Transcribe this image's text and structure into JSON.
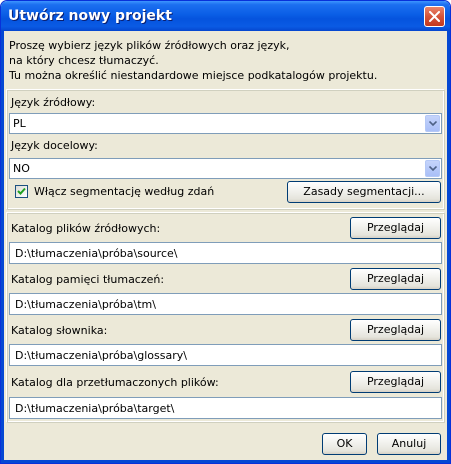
{
  "window": {
    "title": "Utwórz nowy projekt"
  },
  "intro": "Proszę wybierz język plików źródłowych oraz język,\nna który chcesz tłumaczyć.\nTu można określić niestandardowe miejsce podkatalogów projektu.",
  "languages": {
    "source_label": "Język źródłowy:",
    "source_value": "PL",
    "target_label": "Język docelowy:",
    "target_value": "NO",
    "segmentation_checkbox_label": "Włącz segmentację według zdań",
    "segmentation_checked": true,
    "segmentation_rules_button": "Zasady segmentacji..."
  },
  "directories": {
    "browse_label": "Przeglądaj",
    "source": {
      "label": "Katalog plików źródłowych:",
      "path": "D:\\tłumaczenia\\próba\\source\\"
    },
    "tm": {
      "label": "Katalog pamięci tłumaczeń:",
      "path": "D:\\tłumaczenia\\próba\\tm\\"
    },
    "glossary": {
      "label": "Katalog słownika:",
      "path": "D:\\tłumaczenia\\próba\\glossary\\"
    },
    "target": {
      "label": "Katalog dla przetłumaczonych plików:",
      "path": "D:\\tłumaczenia\\próba\\target\\"
    }
  },
  "footer": {
    "ok_label": "OK",
    "cancel_label": "Anuluj"
  },
  "colors": {
    "titlebar": "#0a5ee6",
    "dialog_bg": "#ece9d8",
    "checkmark": "#21a121"
  }
}
